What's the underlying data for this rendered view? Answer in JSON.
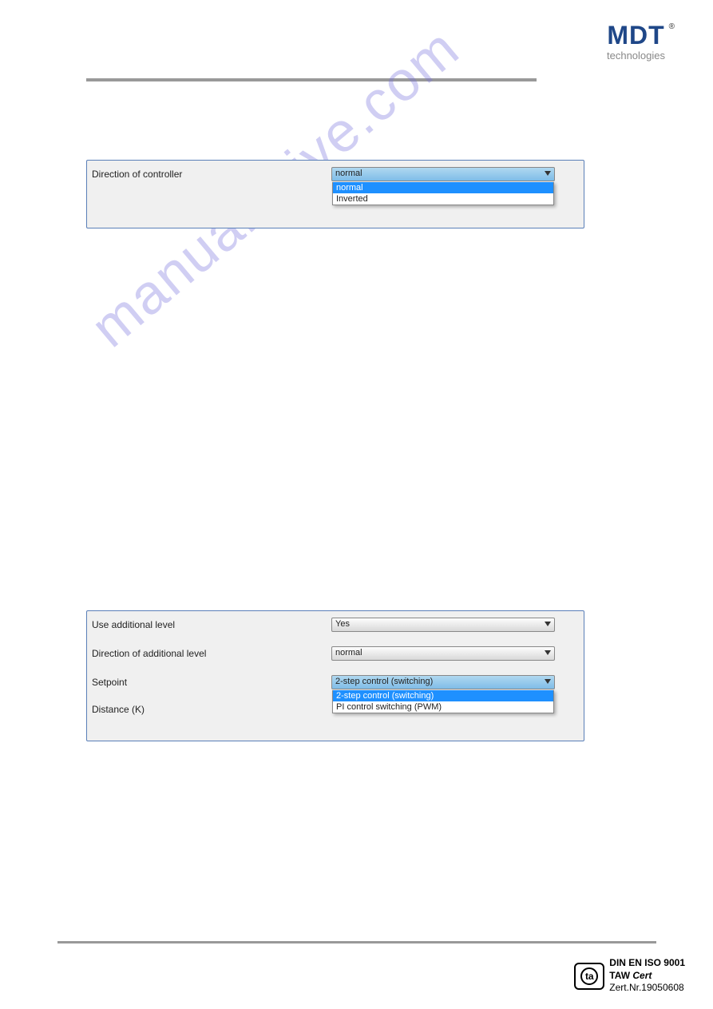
{
  "logo": {
    "main": "MDT",
    "sub": "technologies",
    "reg": "®"
  },
  "panel1": {
    "label": "Direction of controller",
    "selected": "normal",
    "options": [
      "normal",
      "Inverted"
    ]
  },
  "panel2": {
    "row1": {
      "label": "Use additional level",
      "value": "Yes"
    },
    "row2": {
      "label": "Direction of additional level",
      "value": "normal"
    },
    "row3": {
      "label": "Setpoint",
      "selected": "2-step control (switching)",
      "options": [
        "2-step control (switching)",
        "PI control switching (PWM)"
      ]
    },
    "row4": {
      "label": "Distance (K)"
    }
  },
  "watermark": "manualshive.com",
  "footer": {
    "line1": "DIN EN ISO 9001",
    "line2a": "TAW ",
    "line2b": "Cert",
    "line3": "Zert.Nr.19050608",
    "icon": "ta"
  }
}
